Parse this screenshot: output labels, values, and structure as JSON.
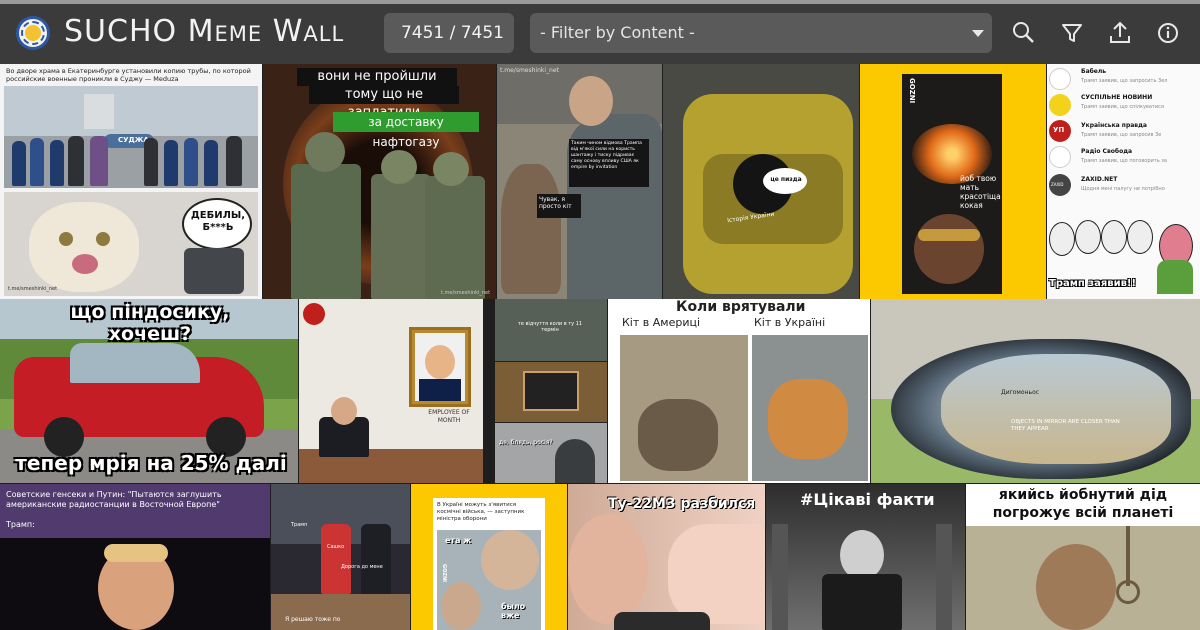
{
  "app": {
    "title": "SUCHO Meme Wall",
    "counter": "7451 / 7451",
    "filter_placeholder": "- Filter by Content -",
    "icons": [
      "search-icon",
      "filter-icon",
      "upload-icon",
      "info-icon"
    ]
  },
  "tiles": {
    "t1": {
      "caption": "Во дворе храма в Екатеринбурге установили копию трубы, по которой российские военные проникли в Суджу — Meduza",
      "sign": "СУДЖА",
      "bubble": "ДЕБИЛЫ, Б***Ь",
      "watermark": "t.me/smeshinki_net"
    },
    "t2": {
      "line1": "вони не пройшли",
      "line2": "тому що не заплатили",
      "line3": "за доставку нафтогазу",
      "watermark": "t.me/smeshinki_net"
    },
    "t3": {
      "url": "t.me/smeshinki_net",
      "bubble1": "Таким чином відмова Трампа від м'якої сили на користь шантажу і тиску підриває саму основу впливу США як empire by invitation",
      "bubble2": "Чувак, я просто кіт"
    },
    "t4": {
      "bubble": "це пизда",
      "label": "Історія України"
    },
    "t5": {
      "logo": "GOZNI",
      "text": "йоб твою мать красотіща кокая"
    },
    "t6": {
      "items": [
        {
          "name": "Бабель",
          "text": "Трамп заявив, що запросить Зел"
        },
        {
          "name": "СУСПІЛЬНЕ НОВИНИ",
          "text": "Трамп заявив, що спілкуватися"
        },
        {
          "name": "Українська правда",
          "text": "Трамп заявив, що запросив Зе"
        },
        {
          "name": "Радіо Свобода",
          "text": "Трамп заявив, що поговорить за"
        },
        {
          "name": "ZAXID.NET",
          "text": "Щодня мені палугу не потрібно"
        }
      ],
      "badges": [
        "УП",
        "ZAXID"
      ],
      "caption": "Трамп заявив!!"
    },
    "t7": {
      "top": "що піндосику, хочеш?",
      "bottom": "тепер мрія на 25% далі"
    },
    "t8": {
      "frame": "EMPLOYEE OF MONTH"
    },
    "t9": {
      "text1": "те відчуття коли в ту 11 термін",
      "text2": "де, блядь, росія?"
    },
    "t10": {
      "title": "Коли врятували",
      "left": "Кіт в Америці",
      "right": "Кіт в Україні"
    },
    "t11": {
      "label": "Дигомоньос",
      "mirror": "OBJECTS IN MIRROR ARE CLOSER THAN THEY APPEAR"
    },
    "t12": {
      "caption": "Советские генсеки и Путин: \"Пытаются заглушить американские радиостанции в Восточной Европе\"",
      "sub": "Трамп:"
    },
    "t13": {
      "labels": [
        "Трамп",
        "Сашко",
        "Дорога до мене"
      ],
      "footer": "Я решаю тоже по"
    },
    "t14": {
      "caption": "В Україні можуть з'явитися космічні війська, — заступник міністра оборони",
      "bubble1": "ета ж",
      "bubble2": "было вже",
      "logo": "GOZNI"
    },
    "t15": {
      "caption": "Ту-22М3 разбился"
    },
    "t16": {
      "caption": "#Цікаві факти"
    },
    "t17": {
      "caption": "якийсь йобнутий дід погрожує всій планеті"
    }
  },
  "colors": {
    "topbar": "#3b3b3b",
    "accent_blue": "#2b57a3",
    "yellow": "#fcc800",
    "green_caption": "#2e9c2e"
  }
}
